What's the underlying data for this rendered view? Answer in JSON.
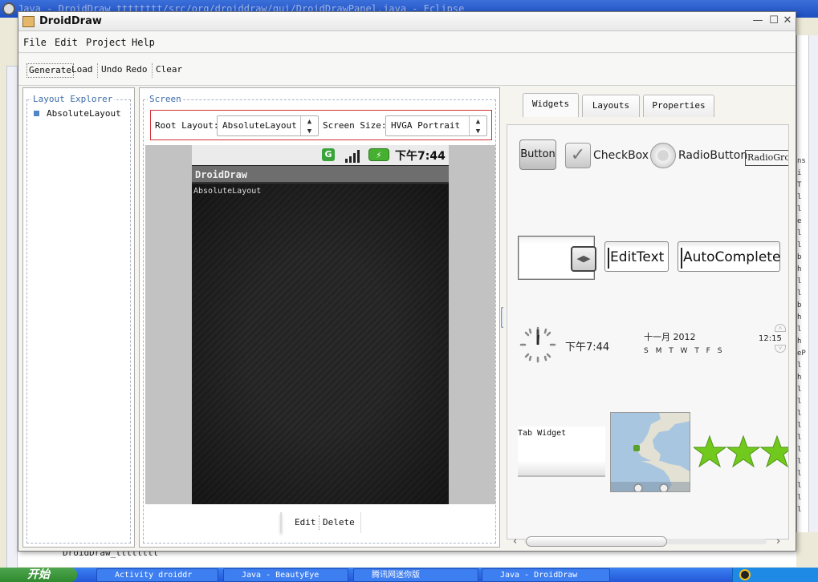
{
  "eclipse": {
    "title": "Java - DroidDraw tttttttt/src/org/droiddraw/gui/DroidDrawPanel.java - Eclipse",
    "bottom_text": "DroidDraw_tttttttt",
    "code_fragments": [
      "ns",
      "i",
      "T",
      "l",
      "l",
      "e",
      "l",
      "l",
      "b",
      "h",
      "l",
      "l",
      "b",
      "h",
      "l",
      "h",
      "eP",
      "l",
      "h",
      "l",
      "l",
      "l",
      "l",
      "l",
      "l",
      "l",
      "l",
      "l",
      "l",
      "l"
    ]
  },
  "window": {
    "title": "DroidDraw",
    "controls": {
      "minimize": "—",
      "maximize": "☐",
      "close": "✕"
    }
  },
  "menu": {
    "file": "File",
    "edit": "Edit",
    "project": "Project",
    "help": "Help"
  },
  "toolbar": {
    "generate": "Generate",
    "load": "Load",
    "undo": "Undo",
    "redo": "Redo",
    "clear": "Clear"
  },
  "layout_explorer": {
    "title": "Layout Explorer",
    "items": [
      "AbsoluteLayout"
    ]
  },
  "screen": {
    "title": "Screen",
    "root_layout_label": "Root Layout:",
    "root_layout_value": "AbsoluteLayout",
    "screen_size_label": "Screen Size:",
    "screen_size_value": "HVGA Portrait",
    "phone": {
      "status_time": "下午7:44",
      "app_title": "DroidDraw",
      "content_label": "AbsoluteLayout"
    },
    "edit_label": "Edit",
    "delete_label": "Delete"
  },
  "tabs": {
    "widgets": "Widgets",
    "layouts": "Layouts",
    "properties": "Properties"
  },
  "widgets": {
    "button": "Button",
    "checkbox": "CheckBox",
    "radiobutton": "RadioButton",
    "radiogroup": "RadioGrou",
    "edittext": "EditText",
    "autocomplete": "AutoComplete",
    "clock_time": "下午7:44",
    "datepicker_month": "十一月 2012",
    "datepicker_days": "S M T W T F S",
    "timepicker": "12:15",
    "tab_widget": "Tab Widget"
  },
  "taskbar": {
    "start": "开始",
    "items": [
      "Activity droiddr",
      "Java - BeautyEye",
      "腾讯网迷你版",
      "Java - DroidDraw"
    ]
  }
}
